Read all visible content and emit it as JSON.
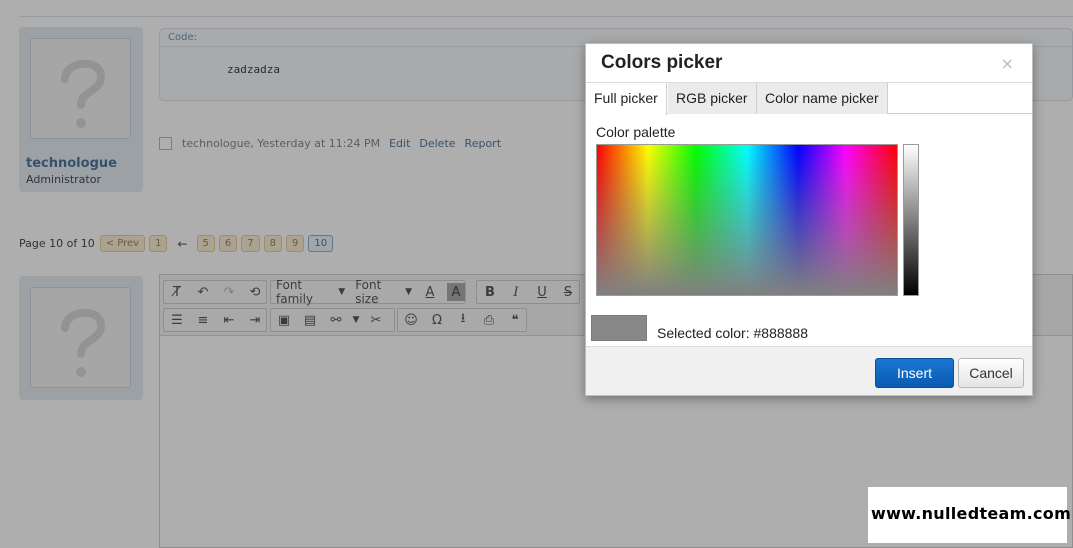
{
  "post": {
    "username": "technologue",
    "role": "Administrator",
    "code_label": "Code:",
    "code_text": "zadzadza",
    "meta_info": "technologue, Yesterday at 11:24 PM",
    "actions": [
      "Edit",
      "Delete",
      "Report"
    ]
  },
  "pagination": {
    "label": "Page 10 of 10",
    "prev": "< Prev",
    "first": "1",
    "gap_arrow": "←",
    "pages": [
      "5",
      "6",
      "7",
      "8",
      "9"
    ],
    "current": "10"
  },
  "editor": {
    "font_family": "Font family",
    "font_size": "Font size",
    "text_color_glyph": "A",
    "bg_color_glyph": "A",
    "bold_glyph": "B",
    "italic_glyph": "I",
    "underline_glyph": "U",
    "strike_glyph": "S",
    "omega_glyph": "Ω"
  },
  "dialog": {
    "title": "Colors picker",
    "close_glyph": "×",
    "tabs": [
      "Full picker",
      "RGB picker",
      "Color name picker"
    ],
    "active_tab": "Full picker",
    "palette_label": "Color palette",
    "selected_label": "Selected color: #888888",
    "selected_color": "#888888",
    "insert_label": "Insert",
    "cancel_label": "Cancel"
  },
  "colors": {
    "overlay": "rgba(70,70,70,0.44)",
    "accent_link": "#2b5a88",
    "insert_button": "#1a76d1",
    "page_button": "#fbeacd"
  },
  "watermark": "www.nulledteam.com"
}
